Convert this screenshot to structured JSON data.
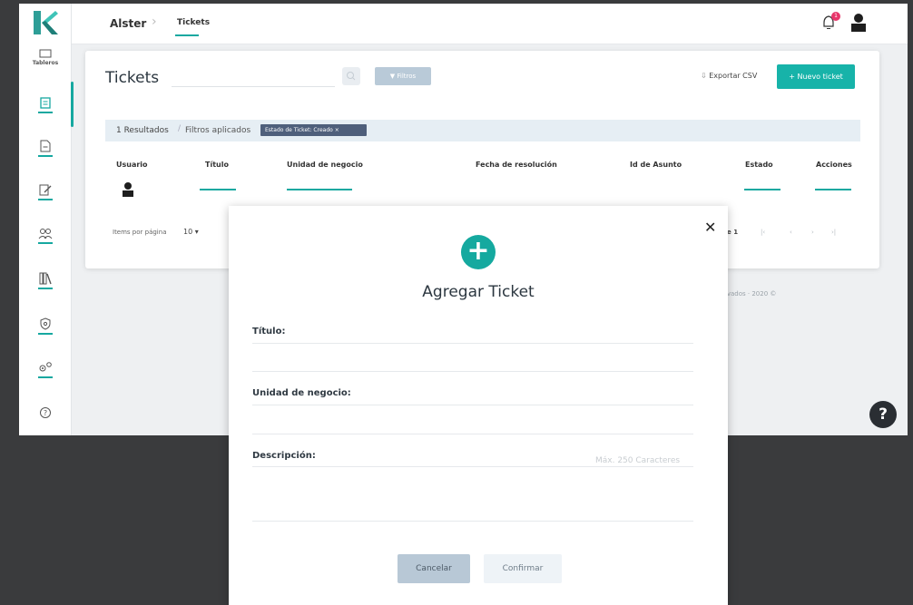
{
  "colors": {
    "accent": "#16a8a0",
    "badge": "#e8356a",
    "chip": "#4f5f7b",
    "filter_btn": "#b9cad8"
  },
  "sidebar": {
    "tableros_label": "Tableros"
  },
  "breadcrumb": {
    "root": "Alster",
    "current": "Tickets"
  },
  "notifications": {
    "count": "1"
  },
  "page": {
    "title": "Tickets",
    "filter_label": "Filtros",
    "export_label": "Exportar CSV",
    "new_ticket_label": "+ Nuevo ticket"
  },
  "results": {
    "count": "1 Resultados",
    "applied_label": "Filtros aplicados",
    "chip": "Estado de Ticket: Creado"
  },
  "table": {
    "headers": [
      "Usuario",
      "Título",
      "Unidad de negocio",
      "Fecha de resolución",
      "Id de Asunto",
      "Estado",
      "Acciones"
    ]
  },
  "pager": {
    "items_label": "Items por página",
    "page_size": "10",
    "page_info": "de 1"
  },
  "footer": {
    "text": "rvados · 2020 ©"
  },
  "help": {
    "label": "?"
  },
  "modal": {
    "title": "Agregar Ticket",
    "fields": {
      "titulo": "Título:",
      "unidad": "Unidad de negocio:",
      "descripcion": "Descripción:"
    },
    "desc_counter": "Máx. 250 Caracteres",
    "cancel_label": "Cancelar",
    "confirm_label": "Confirmar"
  }
}
